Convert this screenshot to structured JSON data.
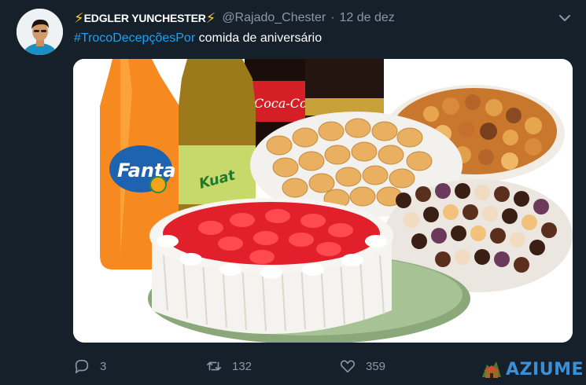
{
  "tweet": {
    "bolt_left": "⚡",
    "display_name": "EDGLER YUNCHESTER",
    "bolt_right": "⚡",
    "handle": "@Rajado_Chester",
    "separator": "·",
    "date": "12 de dez",
    "hashtag": "#TrocoDecepçõesPor",
    "text": " comida de aniversário"
  },
  "media": {
    "labels": {
      "fanta": "Fanta",
      "coca": "Coca-Cola",
      "kuat": "Kuat"
    }
  },
  "actions": {
    "reply_count": "3",
    "retweet_count": "132",
    "like_count": "359"
  },
  "watermark": {
    "text": "AZIUME"
  },
  "colors": {
    "background": "#15202b",
    "accent": "#1da1f2",
    "muted": "#8899a6",
    "bolt": "#ffcc33"
  }
}
